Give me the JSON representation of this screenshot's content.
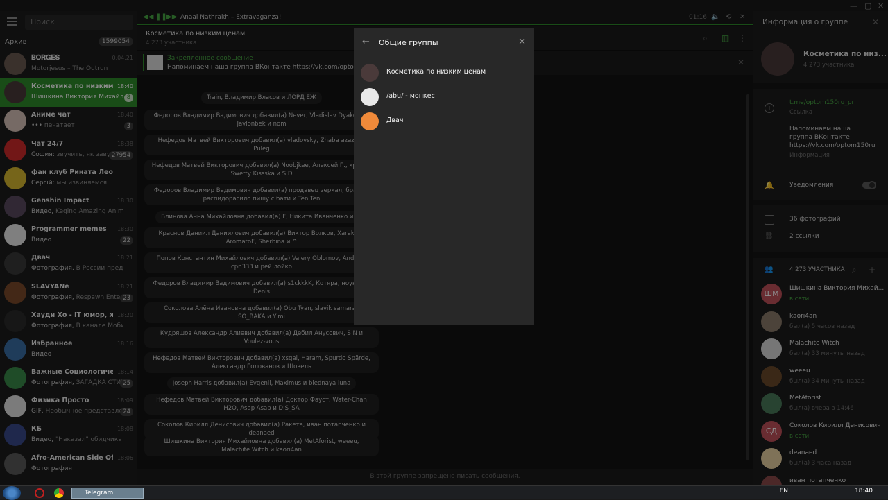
{
  "player": {
    "track": "Anaal Nathrakh – Extravaganza!",
    "time": "01:16"
  },
  "search": {
    "placeholder": "Поиск"
  },
  "archive": {
    "label": "Архив",
    "count": "1599054"
  },
  "chats": [
    {
      "name": "𝐁𝐎𝐑𝐆𝐄𝐒",
      "preview": "Motorjesus – The Outrun",
      "sender": "",
      "time": "0.04.21",
      "badge": "",
      "color": "#6a5a50",
      "type": ""
    },
    {
      "name": "Косметика по низким ...",
      "preview": "Шишкина Виктория Михайло...",
      "sender": "",
      "time": "18:40",
      "badge": "8",
      "color": "#4a3a3a",
      "type": "group",
      "active": true
    },
    {
      "name": "Аниме чат",
      "preview": "печатает",
      "sender": "•••",
      "time": "18:40",
      "badge": "3",
      "color": "#d8c2b8",
      "type": "group"
    },
    {
      "name": "Чат 24/7",
      "preview": "звучить, як завуал...",
      "sender": "София:",
      "time": "18:38",
      "badge": "27954",
      "color": "#d02a2a",
      "type": "group"
    },
    {
      "name": "фан клуб Рината Леон...",
      "preview": "мы извиняемся",
      "sender": "Сергій:",
      "time": "",
      "badge": "",
      "color": "#d8b830",
      "type": "group"
    },
    {
      "name": "Genshin Impact",
      "preview": "Keqing Amazing Anime Styl...",
      "sender": "Видео,",
      "time": "18:30",
      "badge": "",
      "color": "#5a4a60",
      "type": "channel"
    },
    {
      "name": "Programmer memes",
      "preview": "",
      "sender": "Видео",
      "time": "18:30",
      "badge": "22",
      "color": "#e8e8e8",
      "type": "channel"
    },
    {
      "name": "Двач",
      "preview": "В России предложи...",
      "sender": "Фотография,",
      "time": "18:21",
      "badge": "",
      "color": "#3a3a3a",
      "type": "channel"
    },
    {
      "name": "SLAVYANe",
      "preview": "Respawn Entert...",
      "sender": "Фотография,",
      "time": "18:21",
      "badge": "23",
      "color": "#7a4a2a",
      "type": "channel"
    },
    {
      "name": "Хауди Хо - IT юмор, жи...",
      "preview": "В канале Мобильна...",
      "sender": "Фотография,",
      "time": "18:20",
      "badge": "",
      "color": "#2a2a2a",
      "type": "channel"
    },
    {
      "name": "Избранное",
      "preview": "",
      "sender": "Видео",
      "time": "18:16",
      "badge": "",
      "color": "#3a6ea5",
      "type": ""
    },
    {
      "name": "Важные Социологичес...",
      "preview": "ЗАГАДКА СТИВ...",
      "sender": "Фотография,",
      "time": "18:14",
      "badge": "25",
      "color": "#3a8a4a",
      "type": "channel"
    },
    {
      "name": "Физика Просто",
      "preview": "Необычное представлен...",
      "sender": "GIF,",
      "time": "18:09",
      "badge": "24",
      "color": "#e0e0e0",
      "type": "channel"
    },
    {
      "name": "КБ",
      "preview": "\"Наказал\" обидчика на...",
      "sender": "Видео,",
      "time": "18:08",
      "badge": "",
      "color": "#3a4a8a",
      "type": "channel"
    },
    {
      "name": "Afro-American Side Of T...",
      "preview": "",
      "sender": "Фотография",
      "time": "18:06",
      "badge": "",
      "color": "#5a5a5a",
      "type": "channel"
    }
  ],
  "chat": {
    "title": "Косметика по низким ценам",
    "members": "4 273 участника",
    "pinned_title": "Закрепленное сообщение",
    "pinned_text": "Напоминаем наша группа ВКонтакте https://vk.com/optom150ru",
    "footer": "В этой группе запрещено писать сообщения."
  },
  "messages": [
    "Train, Владимир Власов и ЛОРД ЕЖ",
    "Федоров Владимир Вадимович добавил(а) Never, Vladislav Dyakonov, Javlonbek и nom",
    "Нефедов Матвей Викторович добавил(а) vladovsky, Zhaba azazina, Puleg",
    "Нефедов Матвей Викторович добавил(а) Noobjkee, Алексей Г., кринж, Swetty Kissska и S D",
    "Федоров Владимир Вадимович добавил(а) продавец зеркал, братья, распидорасило пишу с бати и Ten Ten",
    "Блинова Анна Михайловна добавил(а) F, Никита Иванченко и Mi",
    "Краснов Даниил Даниилович добавил(а) Виктор Волков, Xarakter, AromatoF, Sherbina и ^",
    "Попов Константин Михайлович добавил(а) Valery Oblomov, Andrew, cpn333 и рей лойко",
    "Федоров Владимир Вадимович добавил(а) s1ckkkK, Котяра, ноунейм, Denis",
    "Соколова Алёна Ивановна добавил(а) Obu Tyan, slavik samarai, SO_BAKA и Y mi",
    "Кудряшов Александр Алиевич добавил(а) Дебил Анусович, S N и Voulez-vous",
    "Нефедов Матвей Викторович добавил(а) xsqai, Haram, Spurdo Spärde, Александр Голованов и Шовель",
    "Joseph Harris добавил(а) Evgenii, Maximus и blednaya luna",
    "Нефедов Матвей Викторович добавил(а) Доктор Фауст, Water-Chan H2O, Asap Asap и DIS_SA",
    "Соколов Кирилл Денисович добавил(а) Ракета, иван потапченко и deanaed",
    "Шишкина Виктория Михайловна добавил(а) MetAforist, weeeu, Malachite Witch и kaori4an"
  ],
  "info": {
    "header": "Информация о группе",
    "group_name": "Косметика по низ...",
    "group_members": "4 273 участника",
    "link": "t.me/optom150ru_pr",
    "link_label": "Ссылка",
    "description": "Напоминаем наша группа ВКонтакте https://vk.com/optom150ru",
    "description_label": "Информация",
    "notifications": "Уведомления",
    "photos": "36 фотографий",
    "links": "2 ссылки",
    "members_header": "4 273 УЧАСТНИКА"
  },
  "members": [
    {
      "name": "Шишкина Виктория Михай...",
      "status": "в сети",
      "online": true,
      "initials": "ШМ",
      "color": "#c0505a"
    },
    {
      "name": "kaori4an",
      "status": "был(а) 5 часов назад",
      "online": false,
      "initials": "",
      "color": "#8a7a6a"
    },
    {
      "name": "Malachite Witch",
      "status": "был(а) 33 минуты назад",
      "online": false,
      "initials": "",
      "color": "#d8d8d8"
    },
    {
      "name": "weeeu",
      "status": "был(а) 34 минуты назад",
      "online": false,
      "initials": "",
      "color": "#6a4a2a"
    },
    {
      "name": "MetAforist",
      "status": "был(а) вчера в 14:46",
      "online": false,
      "initials": "",
      "color": "#4a7a5a"
    },
    {
      "name": "Соколов Кирилл Денисович",
      "status": "в сети",
      "online": true,
      "initials": "СД",
      "color": "#c0505a"
    },
    {
      "name": "deanaed",
      "status": "был(а) 3 часа назад",
      "online": false,
      "initials": "",
      "color": "#e8d0a0"
    },
    {
      "name": "иван потапченко",
      "status": "",
      "online": false,
      "initials": "",
      "color": "#8a4a4a"
    }
  ],
  "modal": {
    "title": "Общие группы",
    "groups": [
      {
        "label": "Косметика по низким ценам",
        "color": "#4a3a3a"
      },
      {
        "label": "/abu/ - монкес",
        "color": "#e8e8e8"
      },
      {
        "label": "Двач",
        "color": "#f08a3a"
      }
    ]
  },
  "taskbar": {
    "app": "Telegram",
    "lang": "EN",
    "clock": "18:40"
  }
}
